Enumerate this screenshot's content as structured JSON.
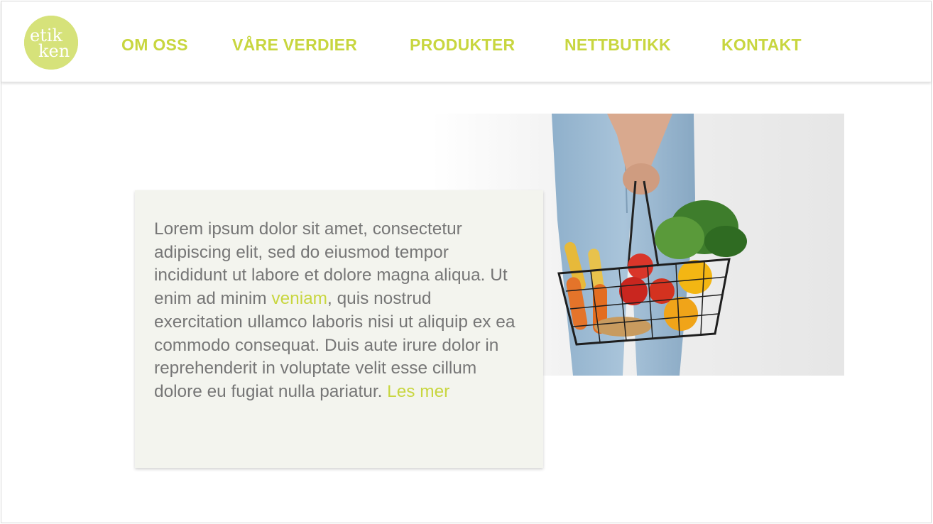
{
  "logo": {
    "text_line1": "etik",
    "text_line2": "ken"
  },
  "nav": {
    "items": [
      {
        "label": "OM OSS"
      },
      {
        "label": "VÅRE VERDIER"
      },
      {
        "label": "PRODUKTER"
      },
      {
        "label": "NETTBUTIKK"
      },
      {
        "label": "KONTAKT"
      }
    ]
  },
  "content": {
    "text_before_link": "Lorem ipsum dolor sit amet, consectetur adipiscing elit, sed do eiusmod tempor incididunt ut labore et dolore magna aliqua. Ut enim ad minim ",
    "inline_link": "veniam",
    "text_after_link": ", quis nostrud exercitation ullamco laboris nisi ut aliquip ex ea commodo consequat. Duis aute irure dolor in reprehenderit in voluptate velit esse cillum dolore eu fugiat nulla pariatur. ",
    "read_more": "Les mer"
  },
  "colors": {
    "accent": "#c8d63f",
    "logo_bg": "#d6e27a",
    "card_bg": "#f3f4ee",
    "body_text": "#767676"
  }
}
